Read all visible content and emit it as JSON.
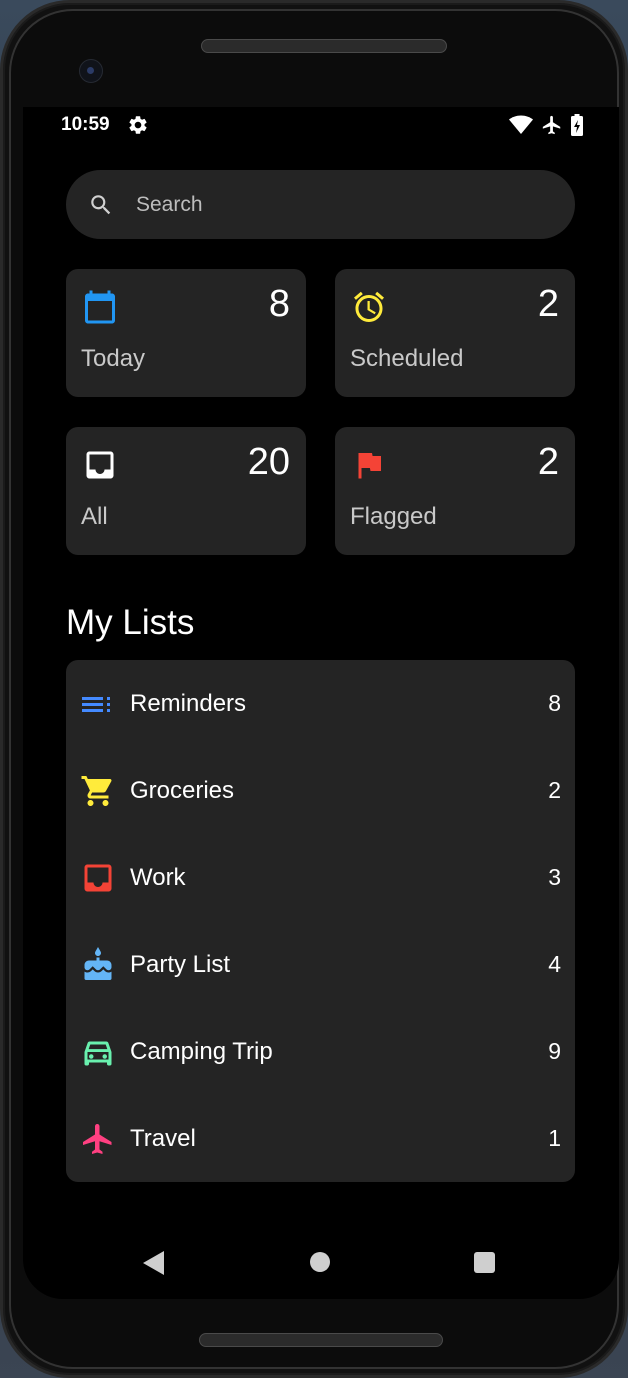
{
  "status_bar": {
    "time": "10:59",
    "icons": [
      "gear-icon",
      "wifi-icon",
      "airplane-icon",
      "battery-charging-icon"
    ]
  },
  "search": {
    "placeholder": "Search",
    "value": ""
  },
  "tiles": [
    {
      "label": "Today",
      "count": "8",
      "icon": "calendar-icon",
      "color": "#2196F3"
    },
    {
      "label": "Scheduled",
      "count": "2",
      "icon": "alarm-clock-icon",
      "color": "#FFEB3B"
    },
    {
      "label": "All",
      "count": "20",
      "icon": "inbox-icon",
      "color": "#FFFFFF"
    },
    {
      "label": "Flagged",
      "count": "2",
      "icon": "flag-icon",
      "color": "#F44336"
    }
  ],
  "my_lists": {
    "title": "My Lists",
    "items": [
      {
        "label": "Reminders",
        "count": "8",
        "icon": "list-icon",
        "color": "#448AFF"
      },
      {
        "label": "Groceries",
        "count": "2",
        "icon": "shopping-cart-icon",
        "color": "#FFEB3B"
      },
      {
        "label": "Work",
        "count": "3",
        "icon": "inbox-icon",
        "color": "#F44336"
      },
      {
        "label": "Party List",
        "count": "4",
        "icon": "cake-icon",
        "color": "#64B5F6"
      },
      {
        "label": "Camping Trip",
        "count": "9",
        "icon": "car-icon",
        "color": "#69F0AE"
      },
      {
        "label": "Travel",
        "count": "1",
        "icon": "airplane-icon",
        "color": "#FF4081"
      }
    ]
  },
  "nav_bar": {
    "icons": [
      "back-icon",
      "home-icon",
      "recents-icon"
    ]
  }
}
